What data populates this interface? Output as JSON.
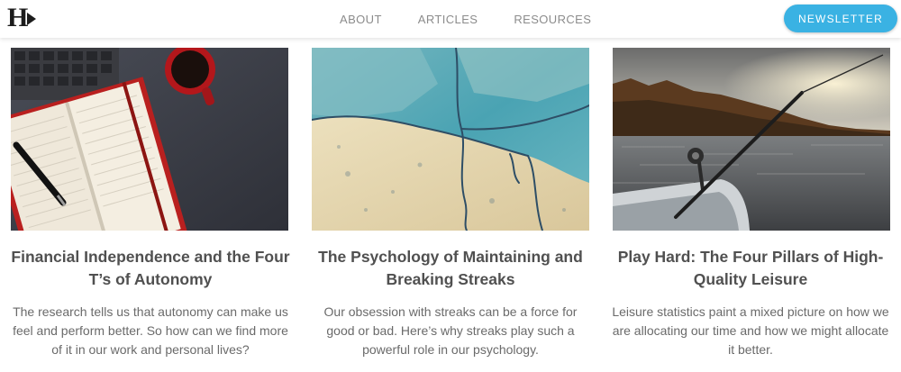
{
  "header": {
    "logo_text": "H",
    "nav": [
      "ABOUT",
      "ARTICLES",
      "RESOURCES"
    ],
    "newsletter_label": "NEWSLETTER",
    "accent_color": "#3ab2e3"
  },
  "articles": [
    {
      "title": "Financial Independence and the Four T’s of Autonomy",
      "description": "The research tells us that autonomy can make us feel and perform better. So how can we find more of it in our work and personal lives?",
      "image": "notebook-pen-coffee-photo"
    },
    {
      "title": "The Psychology of Maintaining and Breaking Streaks",
      "description": "Our obsession with streaks can be a force for good or bad. Here’s why streaks play such a powerful role in our psychology.",
      "image": "cracked-painted-wall-photo"
    },
    {
      "title": "Play Hard: The Four Pillars of High-Quality Leisure",
      "description": "Leisure statistics paint a mixed picture on how we are allocating our time and how we might allocate it better.",
      "image": "fishing-rod-lake-sunset-photo"
    }
  ]
}
